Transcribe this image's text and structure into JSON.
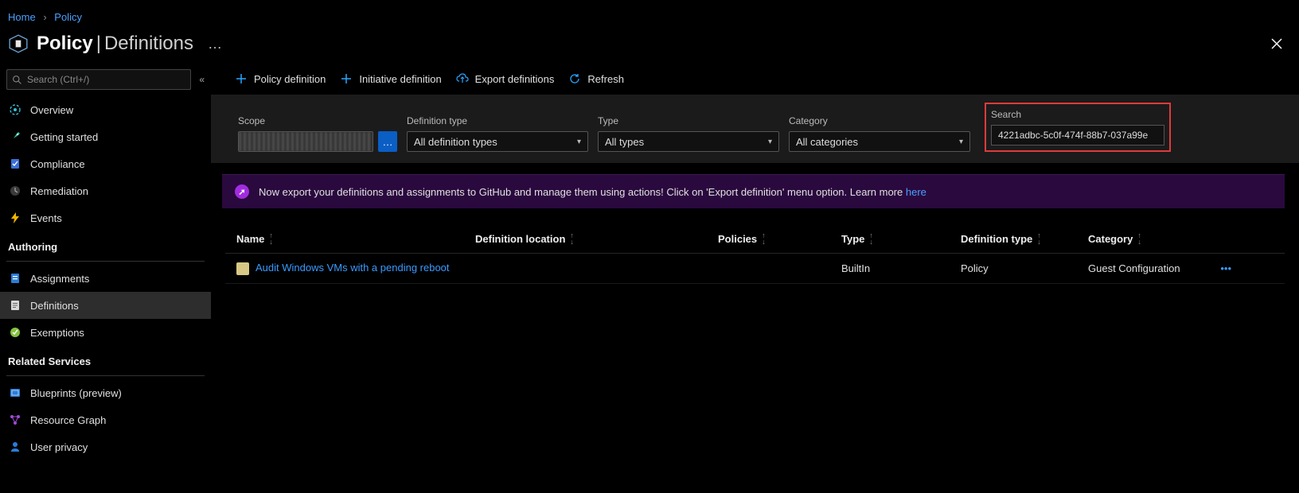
{
  "breadcrumb": {
    "home": "Home",
    "policy": "Policy"
  },
  "title": {
    "main": "Policy",
    "sub": "Definitions"
  },
  "sidebar": {
    "search_placeholder": "Search (Ctrl+/)",
    "items_top": [
      {
        "label": "Overview"
      },
      {
        "label": "Getting started"
      },
      {
        "label": "Compliance"
      },
      {
        "label": "Remediation"
      },
      {
        "label": "Events"
      }
    ],
    "group_authoring": "Authoring",
    "items_authoring": [
      {
        "label": "Assignments"
      },
      {
        "label": "Definitions"
      },
      {
        "label": "Exemptions"
      }
    ],
    "group_related": "Related Services",
    "items_related": [
      {
        "label": "Blueprints (preview)"
      },
      {
        "label": "Resource Graph"
      },
      {
        "label": "User privacy"
      }
    ]
  },
  "toolbar": {
    "policy_def": "Policy definition",
    "initiative_def": "Initiative definition",
    "export_def": "Export definitions",
    "refresh": "Refresh"
  },
  "filters": {
    "scope_label": "Scope",
    "deftype_label": "Definition type",
    "deftype_value": "All definition types",
    "type_label": "Type",
    "type_value": "All types",
    "category_label": "Category",
    "category_value": "All categories",
    "search_label": "Search",
    "search_value": "4221adbc-5c0f-474f-88b7-037a99e"
  },
  "banner": {
    "text": "Now export your definitions and assignments to GitHub and manage them using actions! Click on 'Export definition' menu option. Learn more ",
    "link": "here"
  },
  "table": {
    "headers": {
      "name": "Name",
      "location": "Definition location",
      "policies": "Policies",
      "type": "Type",
      "deftype": "Definition type",
      "category": "Category"
    },
    "rows": [
      {
        "name": "Audit Windows VMs with a pending reboot",
        "location": "",
        "policies": "",
        "type": "BuiltIn",
        "deftype": "Policy",
        "category": "Guest Configuration"
      }
    ]
  }
}
